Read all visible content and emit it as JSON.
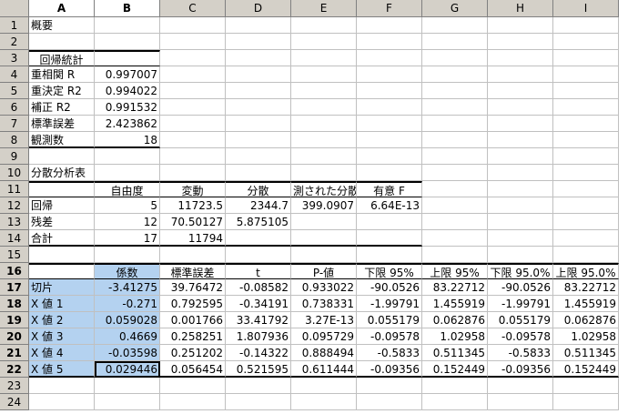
{
  "columns": [
    "A",
    "B",
    "C",
    "D",
    "E",
    "F",
    "G",
    "H",
    "I"
  ],
  "rows": [
    "1",
    "2",
    "3",
    "4",
    "5",
    "6",
    "7",
    "8",
    "9",
    "10",
    "11",
    "12",
    "13",
    "14",
    "15",
    "16",
    "17",
    "18",
    "19",
    "20",
    "21",
    "22",
    "23",
    "24"
  ],
  "cells": {
    "A1": "概要",
    "A3": "回帰統計",
    "A4": "重相関 R",
    "B4": "0.997007",
    "A5": "重決定 R2",
    "B5": "0.994022",
    "A6": "補正 R2",
    "B6": "0.991532",
    "A7": "標準誤差",
    "B7": "2.423862",
    "A8": "観測数",
    "B8": "18",
    "A10": "分散分析表",
    "B11": "自由度",
    "C11": "変動",
    "D11": "分散",
    "E11": "測された分散",
    "F11": "有意 F",
    "A12": "回帰",
    "B12": "5",
    "C12": "11723.5",
    "D12": "2344.7",
    "E12": "399.0907",
    "F12": "6.64E-13",
    "A13": "残差",
    "B13": "12",
    "C13": "70.50127",
    "D13": "5.875105",
    "A14": "合計",
    "B14": "17",
    "C14": "11794",
    "B16": "係数",
    "C16": "標準誤差",
    "D16": "t",
    "E16": "P-値",
    "F16": "下限 95%",
    "G16": "上限 95%",
    "H16": "下限 95.0%",
    "I16": "上限 95.0%",
    "A17": "切片",
    "B17": "-3.41275",
    "C17": "39.76472",
    "D17": "-0.08582",
    "E17": "0.933022",
    "F17": "-90.0526",
    "G17": "83.22712",
    "H17": "-90.0526",
    "I17": "83.22712",
    "A18": "X 値 1",
    "B18": "-0.271",
    "C18": "0.792595",
    "D18": "-0.34191",
    "E18": "0.738331",
    "F18": "-1.99791",
    "G18": "1.455919",
    "H18": "-1.99791",
    "I18": "1.455919",
    "A19": "X 値 2",
    "B19": "0.059028",
    "C19": "0.001766",
    "D19": "33.41792",
    "E19": "3.27E-13",
    "F19": "0.055179",
    "G19": "0.062876",
    "H19": "0.055179",
    "I19": "0.062876",
    "A20": "X 値 3",
    "B20": "0.4669",
    "C20": "0.258251",
    "D20": "1.807936",
    "E20": "0.095729",
    "F20": "-0.09578",
    "G20": "1.02958",
    "H20": "-0.09578",
    "I20": "1.02958",
    "A21": "X 値 4",
    "B21": "-0.03598",
    "C21": "0.251202",
    "D21": "-0.14322",
    "E21": "0.888494",
    "F21": "-0.5833",
    "G21": "0.511345",
    "H21": "-0.5833",
    "I21": "0.511345",
    "A22": "X 値 5",
    "B22": "0.029446",
    "C22": "0.056454",
    "D22": "0.521595",
    "E22": "0.611444",
    "F22": "-0.09356",
    "G22": "0.152449",
    "H22": "-0.09356",
    "I22": "0.152449"
  },
  "colors": {
    "selection": "#b4d2f0",
    "header": "#d4d0c8"
  }
}
